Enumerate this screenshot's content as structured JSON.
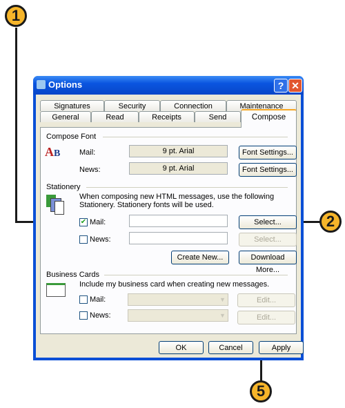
{
  "callouts": [
    "1",
    "2",
    "5"
  ],
  "window": {
    "title": "Options",
    "help": "?",
    "close": "✕"
  },
  "tabs_row1": [
    "Signatures",
    "Security",
    "Connection",
    "Maintenance"
  ],
  "tabs_row2": [
    "General",
    "Read",
    "Receipts",
    "Send",
    "Compose"
  ],
  "active_tab": "Compose",
  "compose_font": {
    "heading": "Compose Font",
    "mail_label": "Mail:",
    "mail_value": "9 pt. Arial",
    "news_label": "News:",
    "news_value": "9 pt. Arial",
    "font_settings": "Font Settings..."
  },
  "stationery": {
    "heading": "Stationery",
    "description": "When composing new HTML messages, use the following Stationery. Stationery fonts will be used.",
    "mail_label": "Mail:",
    "mail_checked": true,
    "news_label": "News:",
    "news_checked": false,
    "select": "Select...",
    "create_new": "Create New...",
    "download_more": "Download More..."
  },
  "business_cards": {
    "heading": "Business Cards",
    "description": "Include my business card when creating new messages.",
    "mail_label": "Mail:",
    "news_label": "News:",
    "edit": "Edit..."
  },
  "footer": {
    "ok": "OK",
    "cancel": "Cancel",
    "apply": "Apply"
  },
  "colors": {
    "callout": "#f6b52a",
    "titlebar": "#0a55e0",
    "active_tab_accent": "#f6a623"
  }
}
